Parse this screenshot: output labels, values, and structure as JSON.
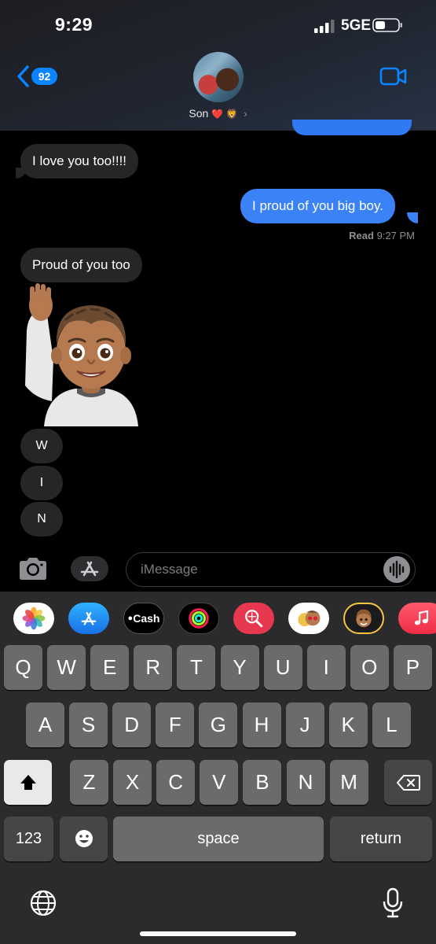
{
  "status_bar": {
    "time": "9:29",
    "network": "5GE"
  },
  "header": {
    "unread_count": "92",
    "contact_name": "Son",
    "contact_emojis": "❤️ 🦁"
  },
  "messages": [
    {
      "from": "received",
      "text": "I love you too!!!!"
    },
    {
      "from": "sent",
      "text": "I proud of you big boy."
    },
    {
      "from": "received",
      "text": "Proud of you too"
    }
  ],
  "read_receipt": {
    "label": "Read",
    "time": "9:27 PM"
  },
  "letters": [
    "W",
    "I",
    "N"
  ],
  "compose": {
    "placeholder": "iMessage"
  },
  "app_drawer": [
    {
      "name": "photos-app-icon"
    },
    {
      "name": "app-store-icon"
    },
    {
      "name": "apple-cash-icon",
      "label": "Cash"
    },
    {
      "name": "activity-icon"
    },
    {
      "name": "image-search-icon"
    },
    {
      "name": "memoji-stickers-icon"
    },
    {
      "name": "animoji-icon"
    },
    {
      "name": "music-icon"
    }
  ],
  "keyboard": {
    "row1": [
      "Q",
      "W",
      "E",
      "R",
      "T",
      "Y",
      "U",
      "I",
      "O",
      "P"
    ],
    "row2": [
      "A",
      "S",
      "D",
      "F",
      "G",
      "H",
      "J",
      "K",
      "L"
    ],
    "row3": [
      "Z",
      "X",
      "C",
      "V",
      "B",
      "N",
      "M"
    ],
    "numbers_label": "123",
    "space_label": "space",
    "return_label": "return"
  },
  "colors": {
    "sent_bubble": "#3a82f6",
    "received_bubble": "#262629",
    "accent": "#0a84ff"
  }
}
